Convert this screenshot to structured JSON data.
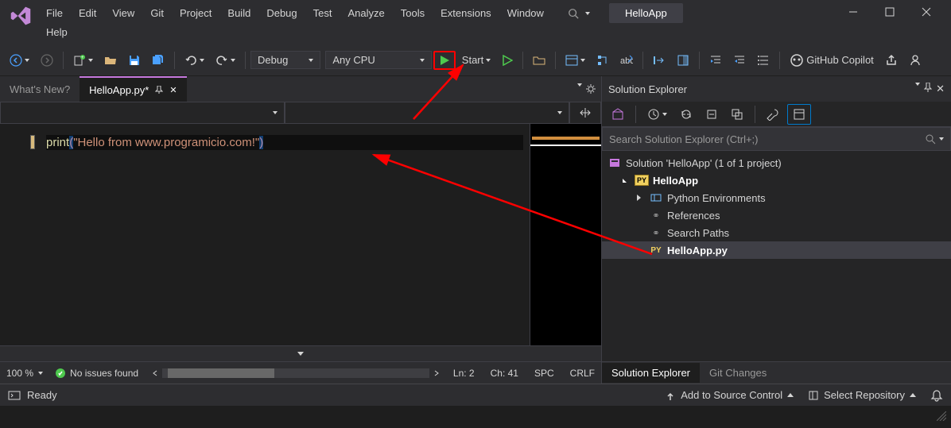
{
  "app_title": "HelloApp",
  "menu": [
    "File",
    "Edit",
    "View",
    "Git",
    "Project",
    "Build",
    "Debug",
    "Test",
    "Analyze",
    "Tools",
    "Extensions",
    "Window",
    "Help"
  ],
  "toolbar": {
    "config": "Debug",
    "platform": "Any CPU",
    "start_label": "Start",
    "copilot_label": "GitHub Copilot"
  },
  "tabs": {
    "inactive": "What's New?",
    "active": "HelloApp.py*"
  },
  "code": {
    "fn": "print",
    "paren_open": "(",
    "str": "\"Hello from www.programicio.com!\"",
    "paren_close": ")"
  },
  "editor_status": {
    "zoom": "100 %",
    "issues": "No issues found",
    "ln": "Ln: 2",
    "ch": "Ch: 41",
    "ins": "SPC",
    "eol": "CRLF"
  },
  "solution": {
    "title": "Solution Explorer",
    "search_placeholder": "Search Solution Explorer (Ctrl+;)",
    "root": "Solution 'HelloApp' (1 of 1 project)",
    "project": "HelloApp",
    "nodes": [
      "Python Environments",
      "References",
      "Search Paths"
    ],
    "file": "HelloApp.py",
    "bottom_tabs": [
      "Solution Explorer",
      "Git Changes"
    ]
  },
  "statusbar": {
    "ready": "Ready",
    "source_control": "Add to Source Control",
    "repo": "Select Repository"
  }
}
